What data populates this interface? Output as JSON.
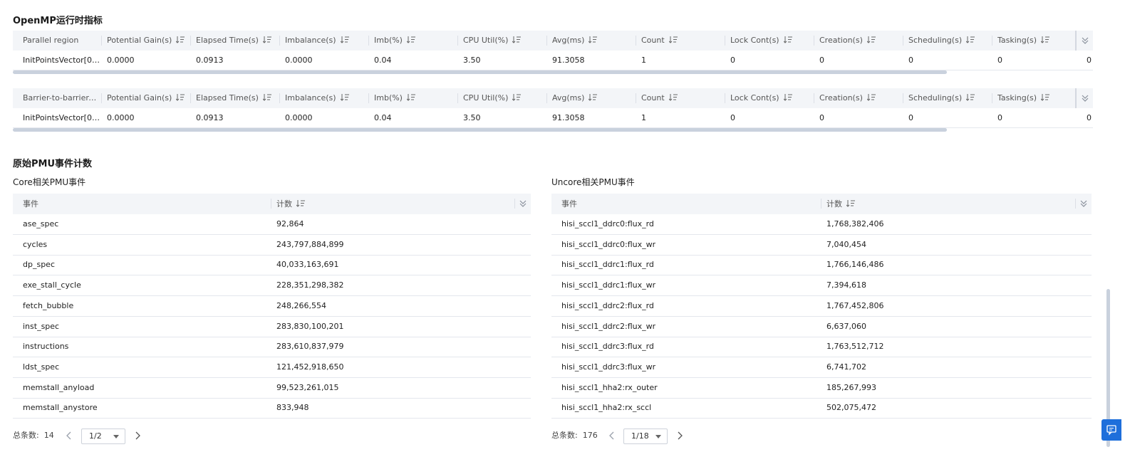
{
  "openmp": {
    "title": "OpenMP运行时指标",
    "columns": [
      "Potential Gain(s)",
      "Elapsed Time(s)",
      "Imbalance(s)",
      "Imb(%)",
      "CPU Util(%)",
      "Avg(ms)",
      "Count",
      "Lock Cont(s)",
      "Creation(s)",
      "Scheduling(s)",
      "Tasking(s)"
    ],
    "tables": [
      {
        "first_col": "Parallel region",
        "row": [
          "InitPointsVector[0]...",
          "0.0000",
          "0.0913",
          "0.0000",
          "0.04",
          "3.50",
          "91.3058",
          "1",
          "0",
          "0",
          "0",
          "0",
          "0"
        ]
      },
      {
        "first_col": "Barrier-to-barrier-se...",
        "row": [
          "InitPointsVector[0]...",
          "0.0000",
          "0.0913",
          "0.0000",
          "0.04",
          "3.50",
          "91.3058",
          "1",
          "0",
          "0",
          "0",
          "0",
          "0"
        ]
      }
    ]
  },
  "pmu": {
    "title": "原始PMU事件计数",
    "core": {
      "title": "Core相关PMU事件",
      "col_event": "事件",
      "col_count": "计数",
      "rows": [
        [
          "ase_spec",
          "92,864"
        ],
        [
          "cycles",
          "243,797,884,899"
        ],
        [
          "dp_spec",
          "40,033,163,691"
        ],
        [
          "exe_stall_cycle",
          "228,351,298,382"
        ],
        [
          "fetch_bubble",
          "248,266,554"
        ],
        [
          "inst_spec",
          "283,830,100,201"
        ],
        [
          "instructions",
          "283,610,837,979"
        ],
        [
          "ldst_spec",
          "121,452,918,650"
        ],
        [
          "memstall_anyload",
          "99,523,261,015"
        ],
        [
          "memstall_anystore",
          "833,948"
        ]
      ],
      "total_label": "总条数:",
      "total": "14",
      "page": "1/2"
    },
    "uncore": {
      "title": "Uncore相关PMU事件",
      "col_event": "事件",
      "col_count": "计数",
      "rows": [
        [
          "hisi_sccl1_ddrc0:flux_rd",
          "1,768,382,406"
        ],
        [
          "hisi_sccl1_ddrc0:flux_wr",
          "7,040,454"
        ],
        [
          "hisi_sccl1_ddrc1:flux_rd",
          "1,766,146,486"
        ],
        [
          "hisi_sccl1_ddrc1:flux_wr",
          "7,394,618"
        ],
        [
          "hisi_sccl1_ddrc2:flux_rd",
          "1,767,452,806"
        ],
        [
          "hisi_sccl1_ddrc2:flux_wr",
          "6,637,060"
        ],
        [
          "hisi_sccl1_ddrc3:flux_rd",
          "1,763,512,712"
        ],
        [
          "hisi_sccl1_ddrc3:flux_wr",
          "6,741,702"
        ],
        [
          "hisi_sccl1_hha2:rx_outer",
          "185,267,993"
        ],
        [
          "hisi_sccl1_hha2:rx_sccl",
          "502,075,472"
        ]
      ],
      "total_label": "总条数:",
      "total": "176",
      "page": "1/18"
    }
  },
  "float_button_icon": "feedback-icon",
  "colors": {
    "header_bg": "#f3f5f8",
    "border": "#e4e7ed",
    "scrollbar": "#c9d1dd",
    "accent": "#1e6fdb"
  }
}
